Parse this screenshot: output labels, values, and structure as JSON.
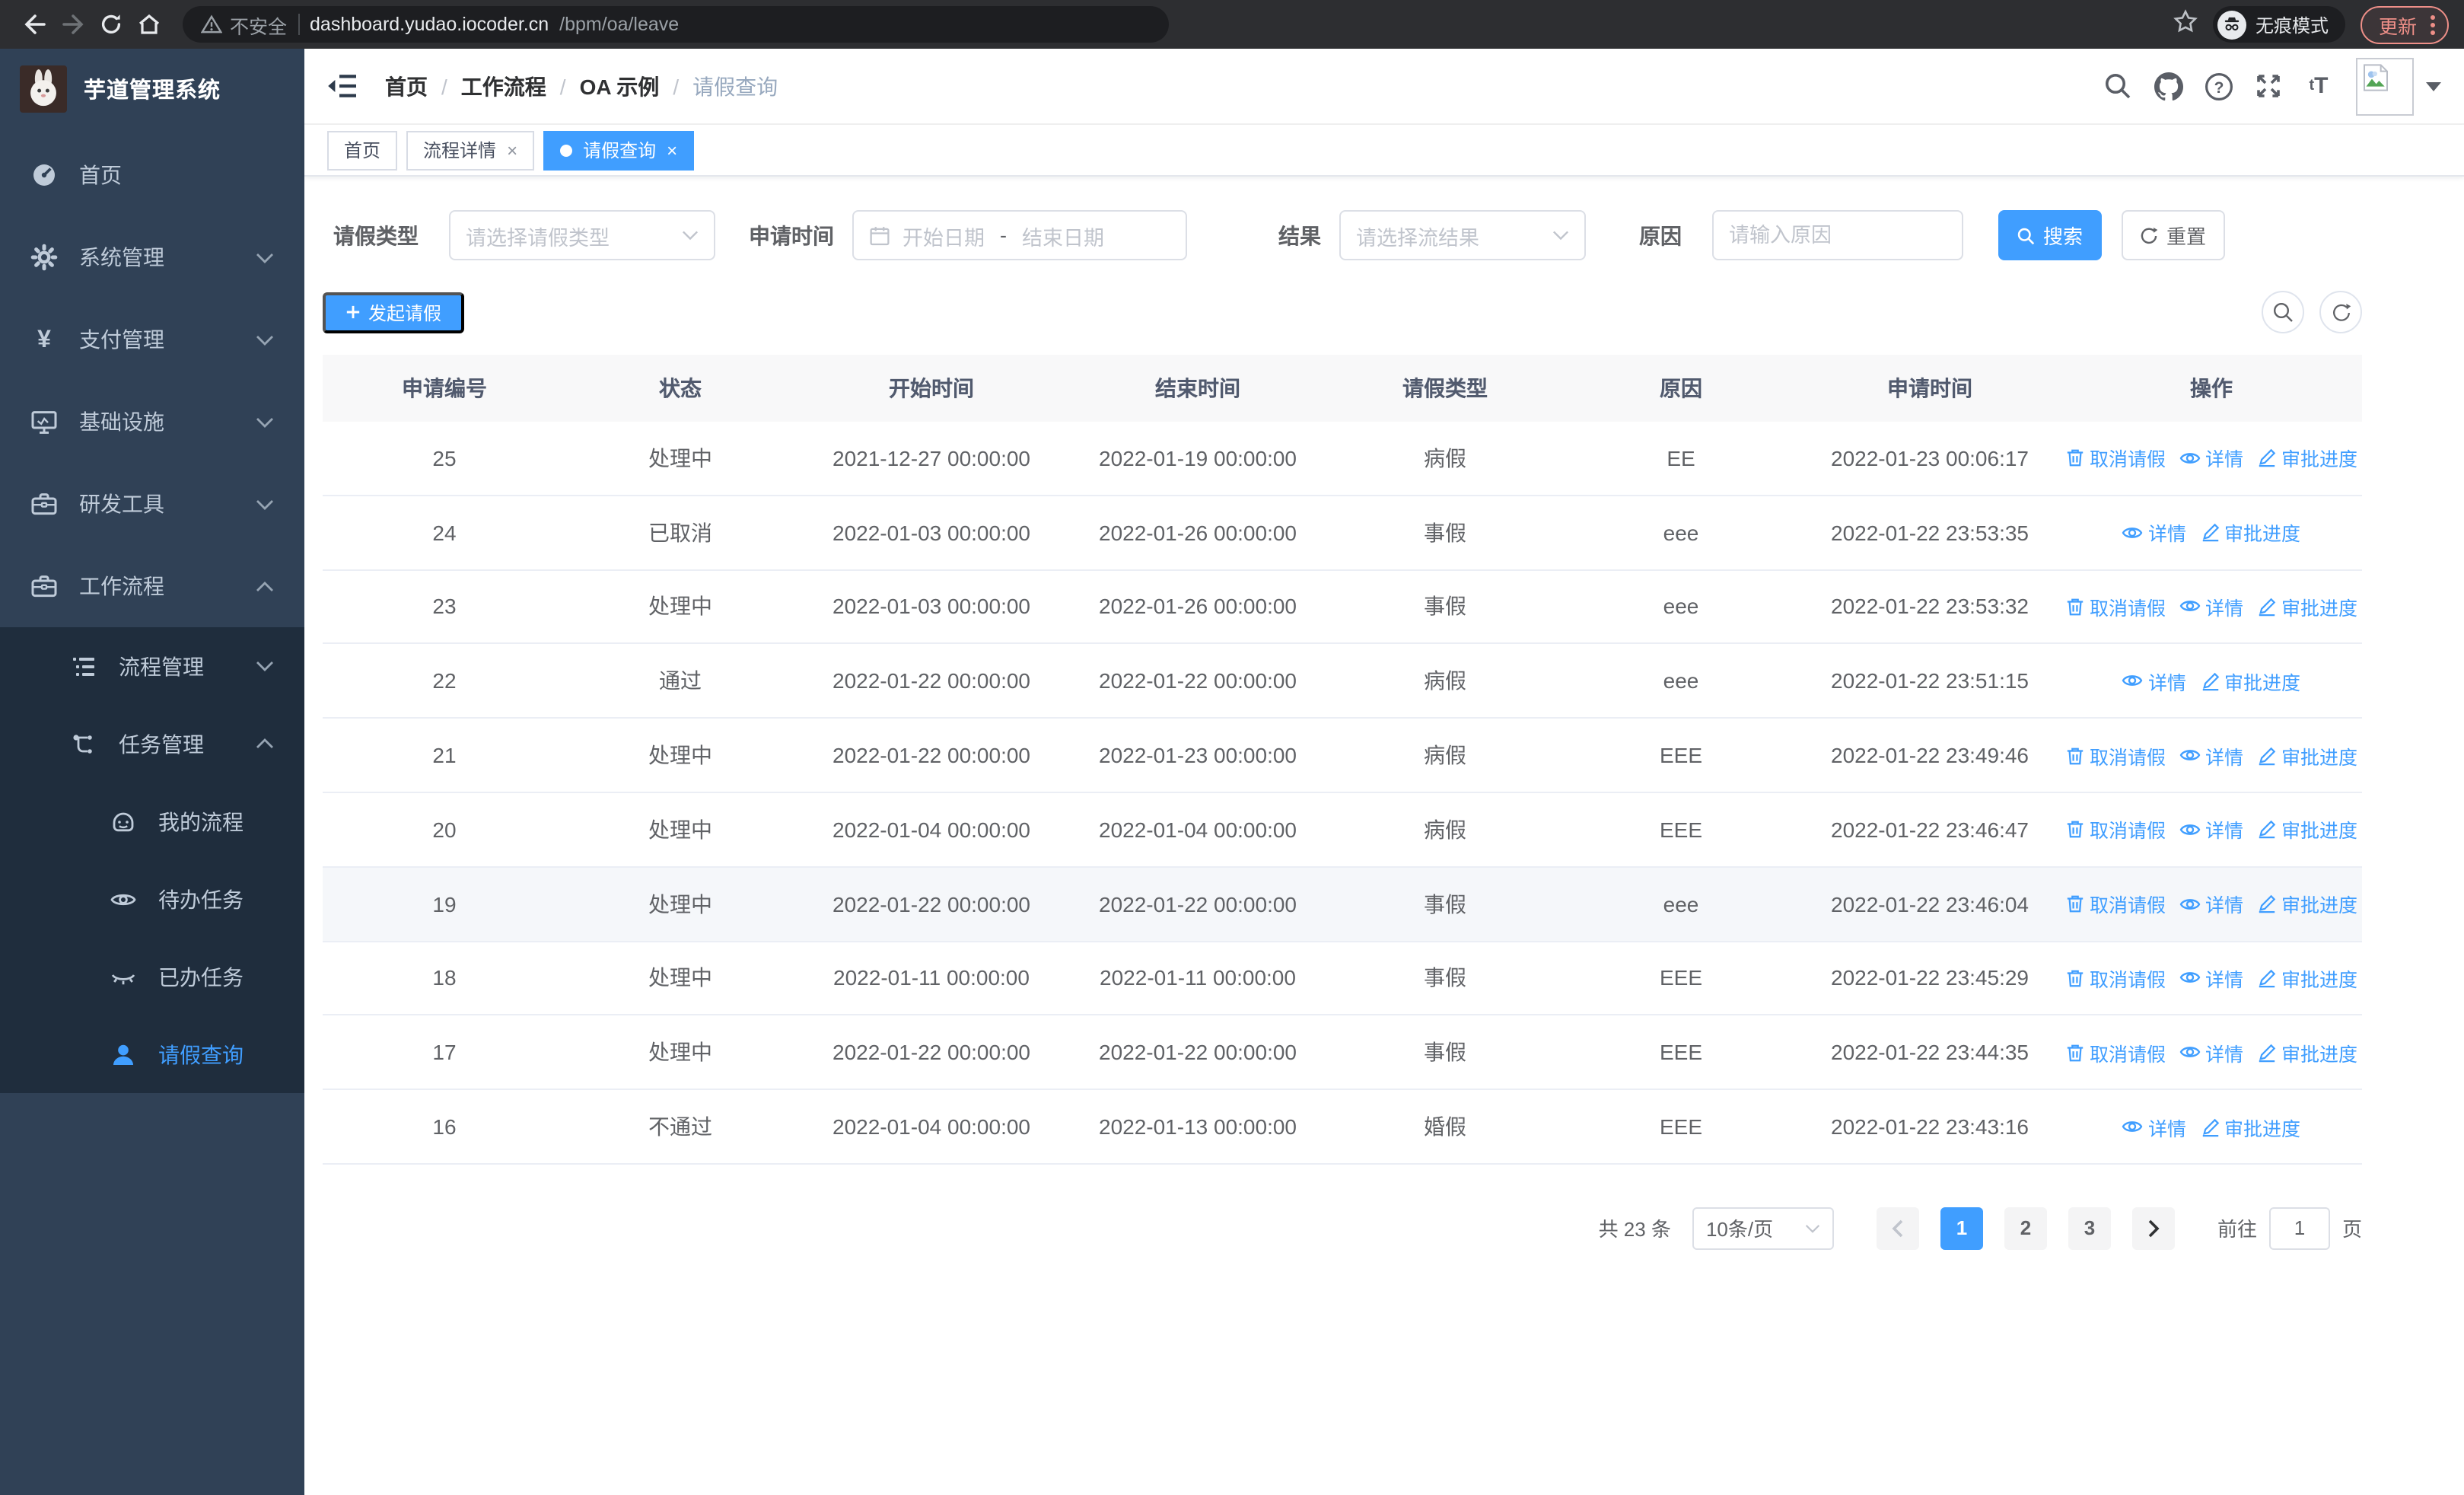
{
  "browser": {
    "security": "不安全",
    "url_host": "dashboard.yudao.iocoder.cn",
    "url_path": "/bpm/oa/leave",
    "incognito": "无痕模式",
    "update": "更新",
    "icons": [
      "back-icon",
      "forward-icon",
      "reload-icon",
      "home-icon",
      "warning-icon",
      "star-icon",
      "incognito-icon",
      "menu-dots-icon"
    ]
  },
  "sidebar": {
    "title": "芋道管理系统",
    "logo_icon": "rabbit-logo",
    "items": [
      {
        "label": "首页",
        "icon": "dashboard-icon"
      },
      {
        "label": "系统管理",
        "icon": "gear-icon",
        "chevron": "down"
      },
      {
        "label": "支付管理",
        "icon": "yen-icon",
        "chevron": "down"
      },
      {
        "label": "基础设施",
        "icon": "monitor-icon",
        "chevron": "down"
      },
      {
        "label": "研发工具",
        "icon": "toolbox-icon",
        "chevron": "down"
      },
      {
        "label": "工作流程",
        "icon": "briefcase-icon",
        "chevron": "up",
        "expanded": true
      },
      {
        "label": "流程管理",
        "icon": "list-tree-icon",
        "chevron": "down",
        "level": 2
      },
      {
        "label": "任务管理",
        "icon": "workflow-icon",
        "chevron": "up",
        "level": 2,
        "expanded": true
      },
      {
        "label": "我的流程",
        "icon": "robot-icon",
        "level": 3
      },
      {
        "label": "待办任务",
        "icon": "eye-open-icon",
        "level": 3
      },
      {
        "label": "已办任务",
        "icon": "eye-closed-icon",
        "level": 3
      },
      {
        "label": "请假查询",
        "icon": "user-icon",
        "level": 3,
        "active": true
      }
    ]
  },
  "breadcrumb": [
    "首页",
    "工作流程",
    "OA 示例",
    "请假查询"
  ],
  "header_icons": [
    "search-icon",
    "github-icon",
    "help-icon",
    "fullscreen-icon",
    "font-size-icon",
    "avatar",
    "caret-down-icon"
  ],
  "tabs": [
    {
      "label": "首页",
      "closable": false,
      "active": false
    },
    {
      "label": "流程详情",
      "closable": true,
      "active": false
    },
    {
      "label": "请假查询",
      "closable": true,
      "active": true
    }
  ],
  "filters": {
    "leave_type_label": "请假类型",
    "leave_type_placeholder": "请选择请假类型",
    "apply_time_label": "申请时间",
    "start_date_placeholder": "开始日期",
    "range_separator": "-",
    "end_date_placeholder": "结束日期",
    "result_label": "结果",
    "result_placeholder": "请选择流结果",
    "reason_label": "原因",
    "reason_placeholder": "请输入原因",
    "search_button": "搜索",
    "reset_button": "重置"
  },
  "toolbar": {
    "create_button": "发起请假"
  },
  "table": {
    "headers": [
      "申请编号",
      "状态",
      "开始时间",
      "结束时间",
      "请假类型",
      "原因",
      "申请时间",
      "操作"
    ],
    "actions_def": {
      "cancel": {
        "label": "取消请假",
        "icon": "trash-icon"
      },
      "detail": {
        "label": "详情",
        "icon": "eye-icon"
      },
      "progress": {
        "label": "审批进度",
        "icon": "edit-pen-icon"
      }
    },
    "rows": [
      {
        "id": "25",
        "status": "处理中",
        "start": "2021-12-27 00:00:00",
        "end": "2022-01-19 00:00:00",
        "type": "病假",
        "reason": "EE",
        "applied": "2022-01-23 00:06:17",
        "actions": [
          "cancel",
          "detail",
          "progress"
        ],
        "highlight": false
      },
      {
        "id": "24",
        "status": "已取消",
        "start": "2022-01-03 00:00:00",
        "end": "2022-01-26 00:00:00",
        "type": "事假",
        "reason": "eee",
        "applied": "2022-01-22 23:53:35",
        "actions": [
          "detail",
          "progress"
        ],
        "highlight": false
      },
      {
        "id": "23",
        "status": "处理中",
        "start": "2022-01-03 00:00:00",
        "end": "2022-01-26 00:00:00",
        "type": "事假",
        "reason": "eee",
        "applied": "2022-01-22 23:53:32",
        "actions": [
          "cancel",
          "detail",
          "progress"
        ],
        "highlight": false
      },
      {
        "id": "22",
        "status": "通过",
        "start": "2022-01-22 00:00:00",
        "end": "2022-01-22 00:00:00",
        "type": "病假",
        "reason": "eee",
        "applied": "2022-01-22 23:51:15",
        "actions": [
          "detail",
          "progress"
        ],
        "highlight": false
      },
      {
        "id": "21",
        "status": "处理中",
        "start": "2022-01-22 00:00:00",
        "end": "2022-01-23 00:00:00",
        "type": "病假",
        "reason": "EEE",
        "applied": "2022-01-22 23:49:46",
        "actions": [
          "cancel",
          "detail",
          "progress"
        ],
        "highlight": false
      },
      {
        "id": "20",
        "status": "处理中",
        "start": "2022-01-04 00:00:00",
        "end": "2022-01-04 00:00:00",
        "type": "病假",
        "reason": "EEE",
        "applied": "2022-01-22 23:46:47",
        "actions": [
          "cancel",
          "detail",
          "progress"
        ],
        "highlight": false
      },
      {
        "id": "19",
        "status": "处理中",
        "start": "2022-01-22 00:00:00",
        "end": "2022-01-22 00:00:00",
        "type": "事假",
        "reason": "eee",
        "applied": "2022-01-22 23:46:04",
        "actions": [
          "cancel",
          "detail",
          "progress"
        ],
        "highlight": true
      },
      {
        "id": "18",
        "status": "处理中",
        "start": "2022-01-11 00:00:00",
        "end": "2022-01-11 00:00:00",
        "type": "事假",
        "reason": "EEE",
        "applied": "2022-01-22 23:45:29",
        "actions": [
          "cancel",
          "detail",
          "progress"
        ],
        "highlight": false
      },
      {
        "id": "17",
        "status": "处理中",
        "start": "2022-01-22 00:00:00",
        "end": "2022-01-22 00:00:00",
        "type": "事假",
        "reason": "EEE",
        "applied": "2022-01-22 23:44:35",
        "actions": [
          "cancel",
          "detail",
          "progress"
        ],
        "highlight": false
      },
      {
        "id": "16",
        "status": "不通过",
        "start": "2022-01-04 00:00:00",
        "end": "2022-01-13 00:00:00",
        "type": "婚假",
        "reason": "EEE",
        "applied": "2022-01-22 23:43:16",
        "actions": [
          "detail",
          "progress"
        ],
        "highlight": false
      }
    ]
  },
  "pagination": {
    "total": "共 23 条",
    "page_size": "10条/页",
    "pages": [
      "1",
      "2",
      "3"
    ],
    "active_page": "1",
    "goto_label": "前往",
    "goto_value": "1",
    "page_suffix": "页"
  },
  "colors": {
    "primary": "#409eff",
    "sidebar_bg": "#304156",
    "submenu_bg": "#1f2d3d",
    "sidebar_text": "#bfcbd9",
    "table_header_bg": "#f8f8f9",
    "update_badge": "#ee8f88"
  }
}
